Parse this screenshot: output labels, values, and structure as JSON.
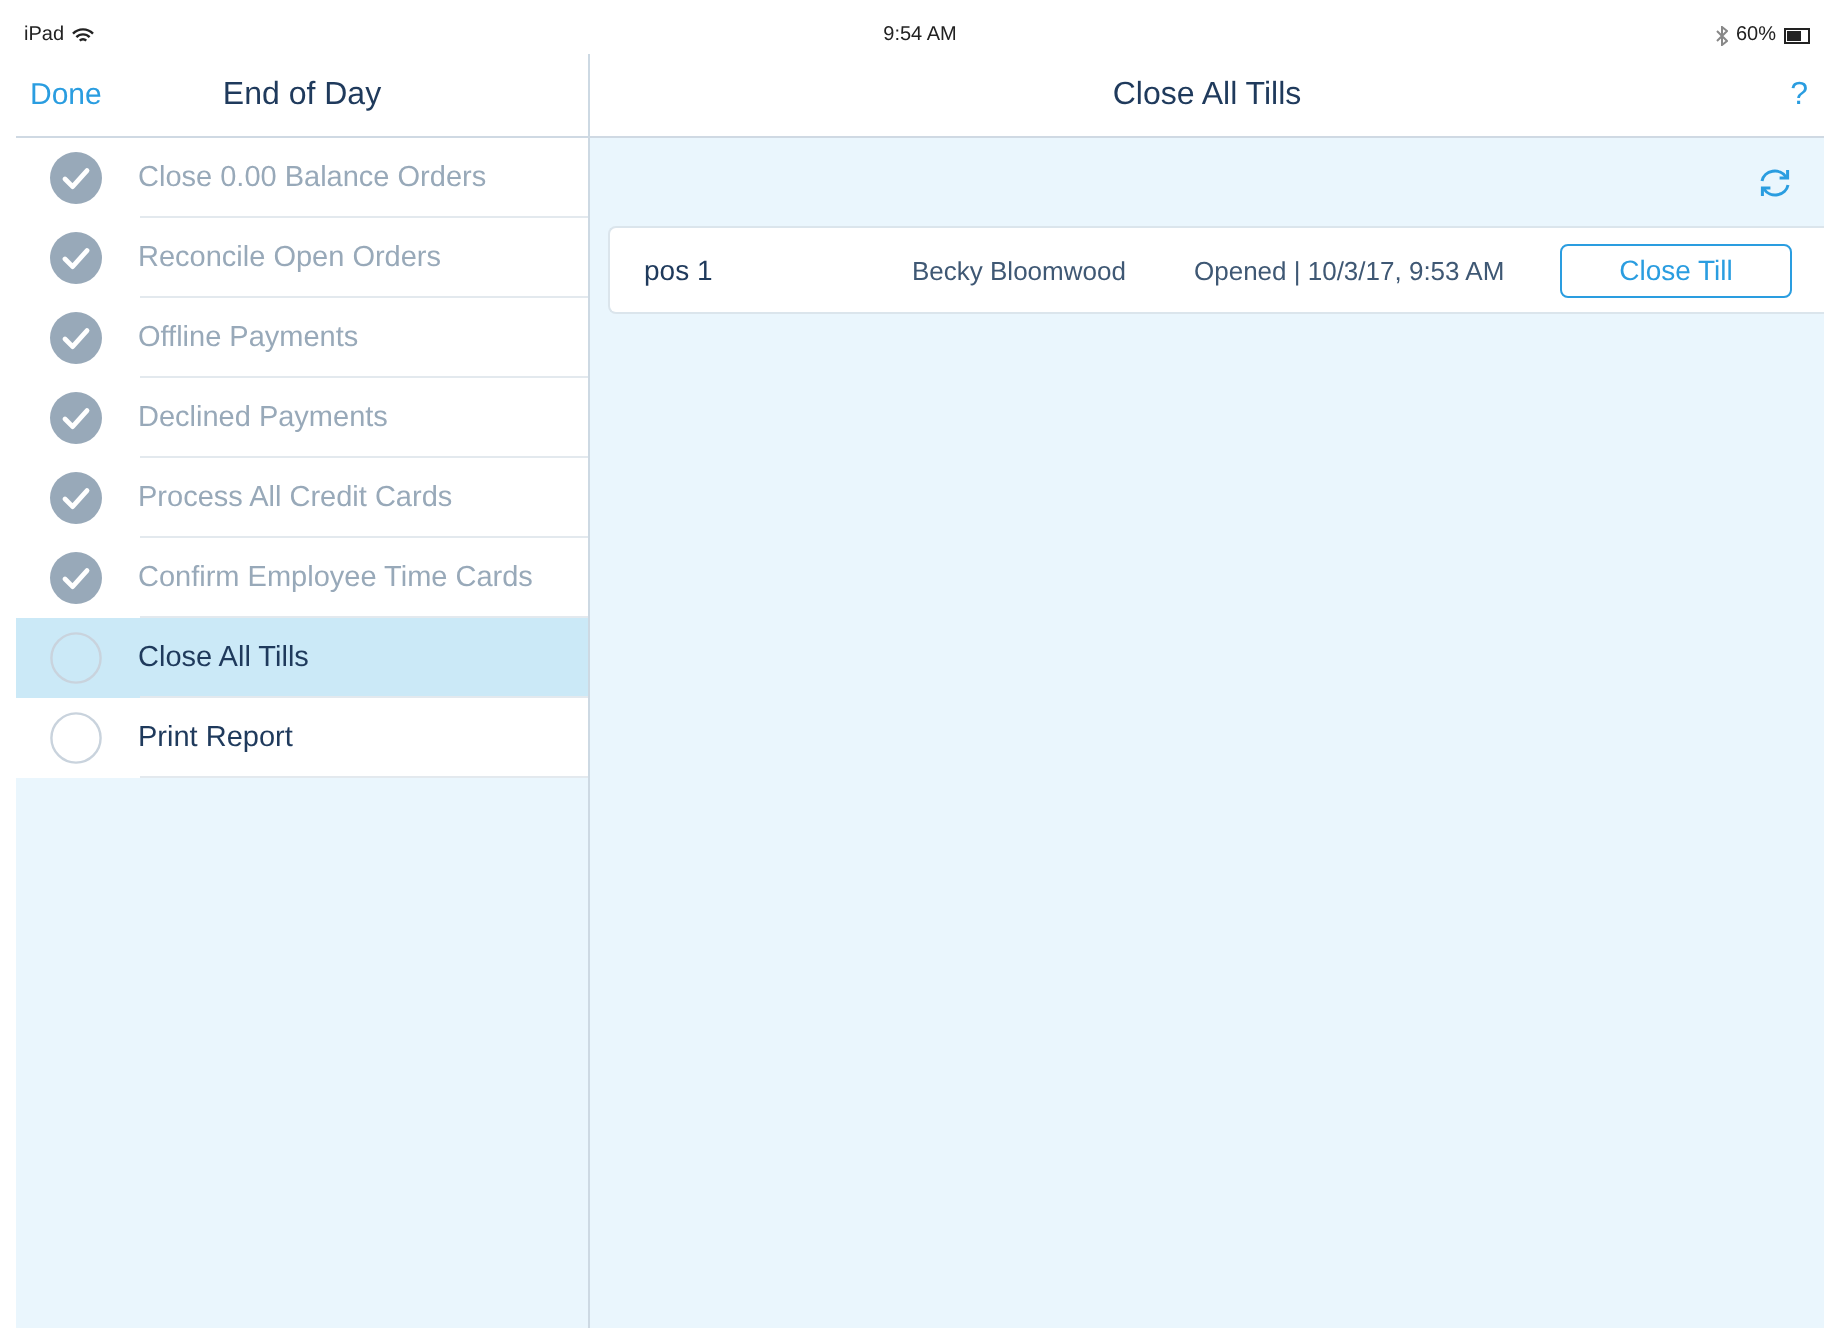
{
  "status_bar": {
    "device": "iPad",
    "time": "9:54 AM",
    "battery": "60%"
  },
  "sidebar": {
    "done": "Done",
    "title": "End of Day",
    "items": [
      {
        "label": "Close 0.00 Balance Orders",
        "checked": true,
        "selected": false
      },
      {
        "label": "Reconcile Open Orders",
        "checked": true,
        "selected": false
      },
      {
        "label": "Offline Payments",
        "checked": true,
        "selected": false
      },
      {
        "label": "Declined Payments",
        "checked": true,
        "selected": false
      },
      {
        "label": "Process All Credit Cards",
        "checked": true,
        "selected": false
      },
      {
        "label": "Confirm Employee Time Cards",
        "checked": true,
        "selected": false
      },
      {
        "label": "Close All Tills",
        "checked": false,
        "selected": true
      },
      {
        "label": "Print Report",
        "checked": false,
        "selected": false
      }
    ]
  },
  "main": {
    "title": "Close All Tills",
    "help": "?",
    "tills": [
      {
        "name": "pos 1",
        "employee": "Becky Bloomwood",
        "status": "Opened | 10/3/17, 9:53 AM",
        "action": "Close Till"
      }
    ]
  }
}
